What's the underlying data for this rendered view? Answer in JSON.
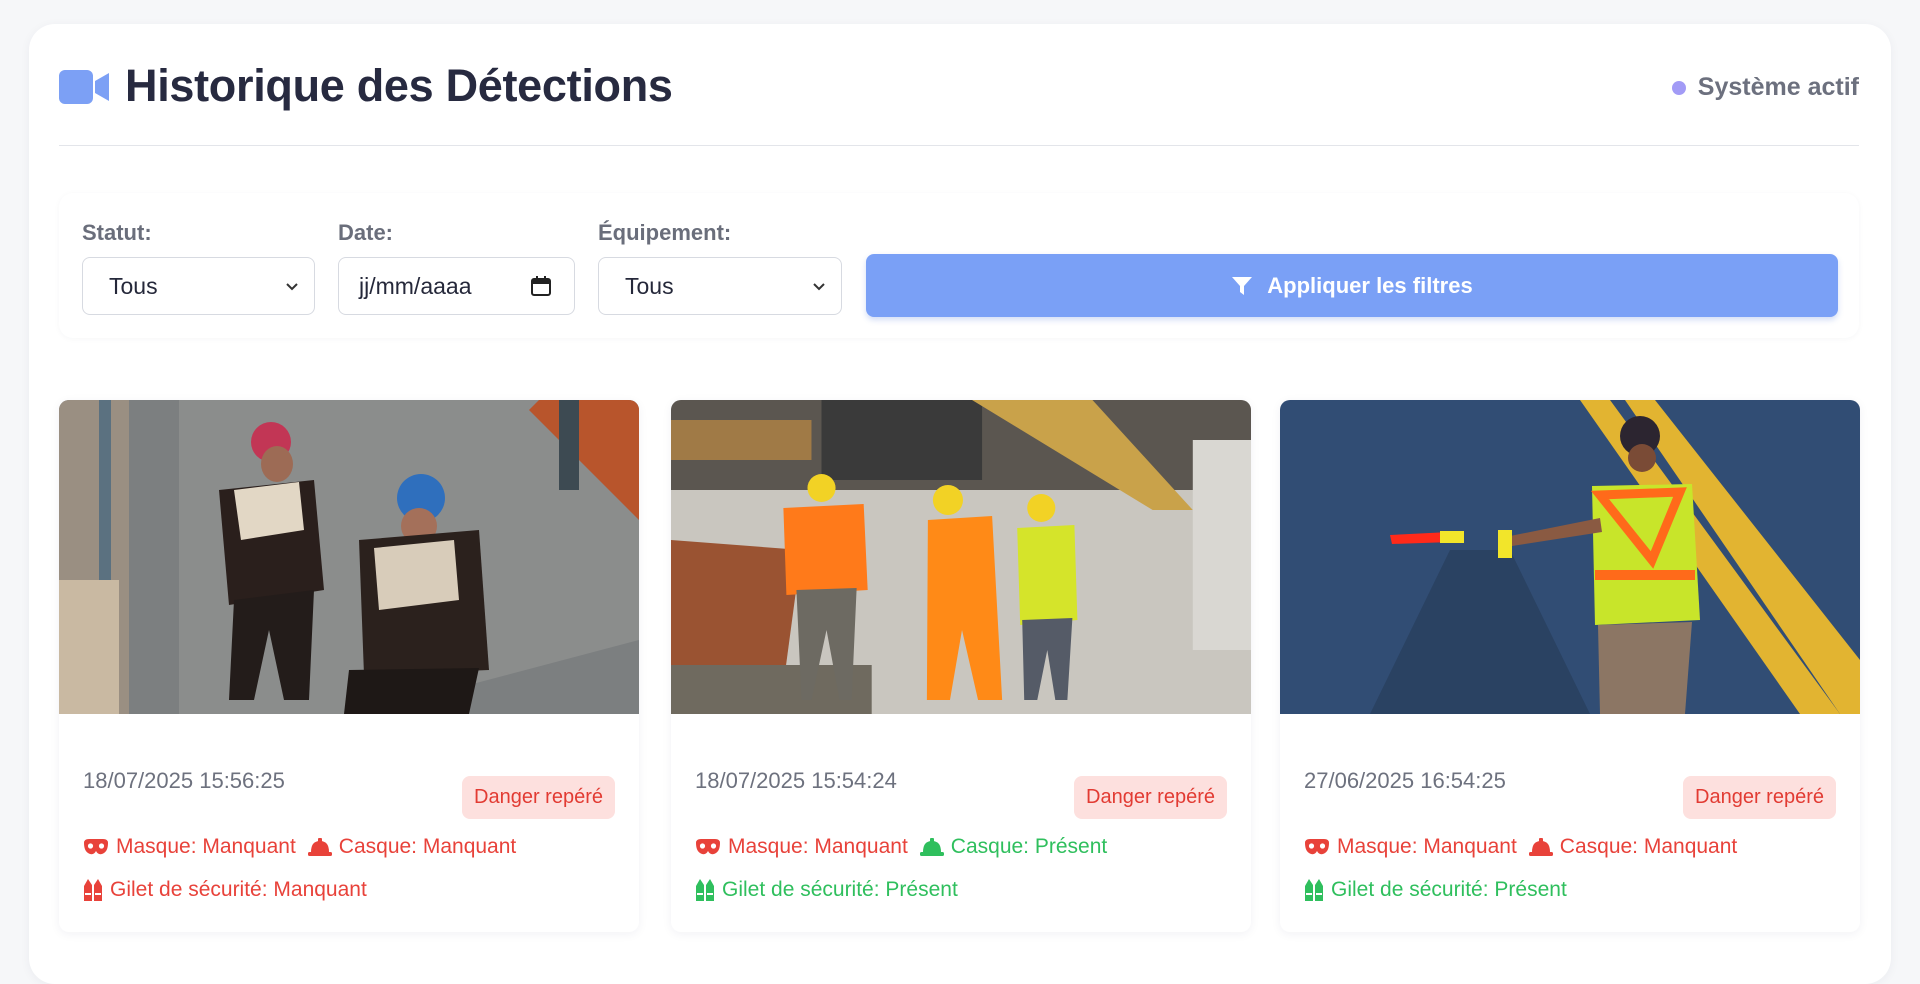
{
  "header": {
    "title": "Historique des Détections",
    "status_text": "Système actif",
    "icon": "video-camera-icon"
  },
  "filters": {
    "status_label": "Statut:",
    "status_value": "Tous",
    "date_label": "Date:",
    "date_placeholder": "jj/mm/aaaa",
    "equipment_label": "Équipement:",
    "equipment_value": "Tous",
    "apply_label": "Appliquer les filtres"
  },
  "colors": {
    "accent": "#7aa0f6",
    "danger": "#e8423a",
    "ok": "#2fbf5d",
    "badge_bg": "#fde0de"
  },
  "cards": [
    {
      "timestamp": "18/07/2025 15:56:25",
      "badge": "Danger repéré",
      "image": "two workers in warehouse aisle",
      "mask": "Masque: Manquant",
      "mask_ok": false,
      "helmet": "Casque: Manquant",
      "helmet_ok": false,
      "vest": "Gilet de sécurité: Manquant",
      "vest_ok": false
    },
    {
      "timestamp": "18/07/2025 15:54:24",
      "badge": "Danger repéré",
      "image": "three construction workers with helmets",
      "mask": "Masque: Manquant",
      "mask_ok": false,
      "helmet": "Casque: Présent",
      "helmet_ok": true,
      "vest": "Gilet de sécurité: Présent",
      "vest_ok": true
    },
    {
      "timestamp": "27/06/2025 16:54:25",
      "badge": "Danger repéré",
      "image": "worker in safety vest directing traffic",
      "mask": "Masque: Manquant",
      "mask_ok": false,
      "helmet": "Casque: Manquant",
      "helmet_ok": false,
      "vest": "Gilet de sécurité: Présent",
      "vest_ok": true
    }
  ]
}
